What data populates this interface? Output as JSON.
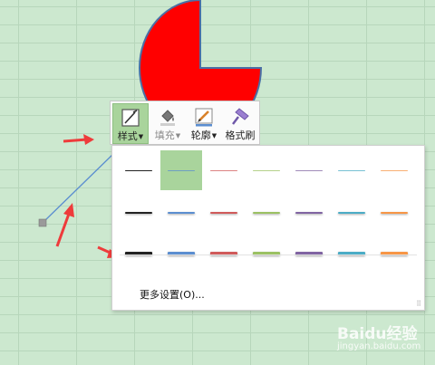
{
  "toolbar": {
    "buttons": [
      {
        "label": "样式",
        "has_dropdown": true,
        "state": "active"
      },
      {
        "label": "填充",
        "has_dropdown": true,
        "state": "disabled"
      },
      {
        "label": "轮廓",
        "has_dropdown": true,
        "state": "normal"
      },
      {
        "label": "格式刷",
        "has_dropdown": false,
        "state": "normal"
      }
    ]
  },
  "line_styles": {
    "colors": [
      "#222222",
      "#5b8ed0",
      "#d05a5a",
      "#9bc163",
      "#8064a2",
      "#4bacc6",
      "#f79646"
    ],
    "rows": [
      {
        "weight": "thin"
      },
      {
        "weight": "medium"
      },
      {
        "weight": "thick"
      }
    ],
    "selected": "row 1, column 2",
    "more_settings_label": "更多设置(O)..."
  },
  "colors": {
    "sheet_background": "#cce8cf",
    "pie_fill": "#ff0000",
    "pie_outline": "#4a6fa5",
    "highlight": "#a9d49c",
    "arrow": "#ee3b3b"
  },
  "watermark": {
    "brand": "Baidu经验",
    "url": "jingyan.baidu.com"
  }
}
